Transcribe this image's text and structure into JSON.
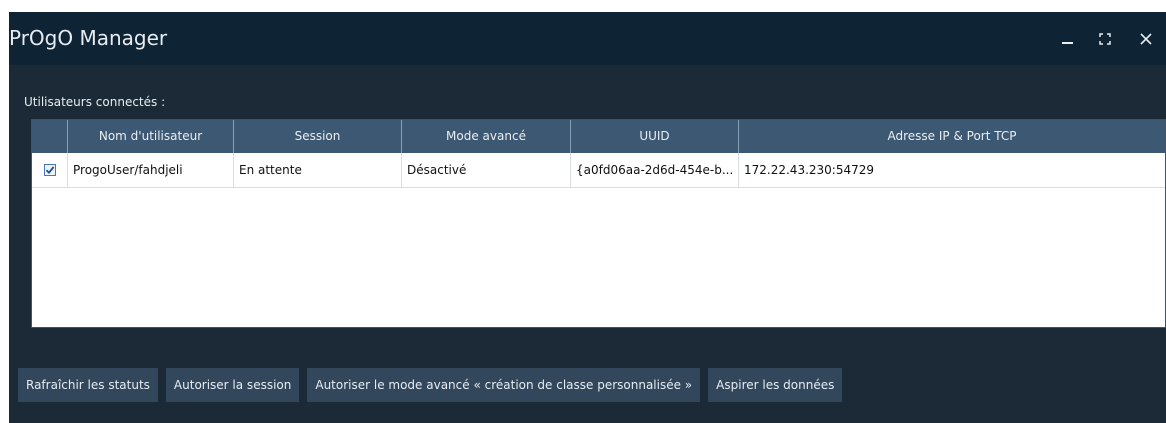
{
  "window": {
    "title": "PrOgO Manager"
  },
  "section": {
    "label": "Utilisateurs connectés :"
  },
  "table": {
    "columns": [
      "",
      "Nom d'utilisateur",
      "Session",
      "Mode avancé",
      "UUID",
      "Adresse IP & Port TCP"
    ],
    "rows": [
      {
        "checked": true,
        "cells": [
          "ProgoUser/fahdjeli",
          "En attente",
          "Désactivé",
          "{a0fd06aa-2d6d-454e-b...",
          "172.22.43.230:54729"
        ]
      }
    ]
  },
  "toolbar": {
    "refresh": "Rafraîchir les statuts",
    "authorize_session": "Autoriser la session",
    "authorize_advanced": "Autoriser le mode avancé « création de classe personnalisée »",
    "fetch_data": "Aspirer les données"
  }
}
